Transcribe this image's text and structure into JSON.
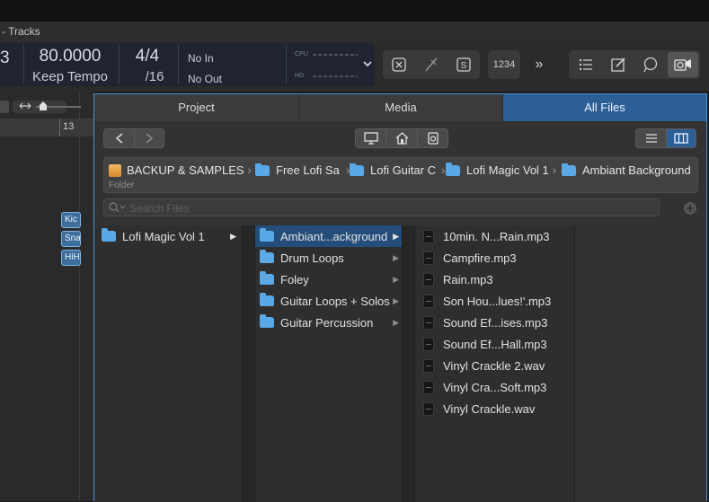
{
  "window": {
    "title": "- Tracks"
  },
  "lcd": {
    "bar_partial": "3",
    "tempo": "80.0000",
    "tempo_mode": "Keep Tempo",
    "time_signature": "4/4",
    "division": "/16",
    "midi_in": "No In",
    "midi_out": "No Out",
    "cpu_label": "CPU",
    "hd_label": "HD"
  },
  "toolbar": {
    "count_in": "1234",
    "more": "»"
  },
  "tracks": {
    "ruler_bar": "13",
    "regions": [
      "Kic",
      "Sna",
      "HiH"
    ]
  },
  "browser": {
    "tabs": [
      {
        "label": "Project"
      },
      {
        "label": "Media"
      },
      {
        "label": "All Files"
      }
    ],
    "path": [
      {
        "label": "BACKUP & SAMPLES"
      },
      {
        "label": "Free Lofi Sa"
      },
      {
        "label": "Lofi Guitar C"
      },
      {
        "label": "Lofi Magic Vol 1"
      },
      {
        "label": "Ambiant Background"
      }
    ],
    "path_caption": "Folder",
    "search_placeholder": "Search Files",
    "column1": [
      {
        "label": "Lofi Magic Vol 1"
      }
    ],
    "column2": [
      {
        "label": "Ambiant...ackground"
      },
      {
        "label": "Drum Loops"
      },
      {
        "label": "Foley"
      },
      {
        "label": "Guitar Loops + Solos"
      },
      {
        "label": "Guitar Percussion"
      }
    ],
    "column3": [
      {
        "label": "10min. N...Rain.mp3"
      },
      {
        "label": "Campfire.mp3"
      },
      {
        "label": "Rain.mp3"
      },
      {
        "label": "Son Hou...lues!'.mp3"
      },
      {
        "label": "Sound Ef...ises.mp3"
      },
      {
        "label": "Sound Ef...Hall.mp3"
      },
      {
        "label": "Vinyl Crackle 2.wav"
      },
      {
        "label": "Vinyl Cra...Soft.mp3"
      },
      {
        "label": "Vinyl Crackle.wav"
      }
    ]
  },
  "colors": {
    "accent": "#2c5f95",
    "folder": "#5aa8e6",
    "selection": "#234e7a",
    "region": "#3d6e9c"
  }
}
